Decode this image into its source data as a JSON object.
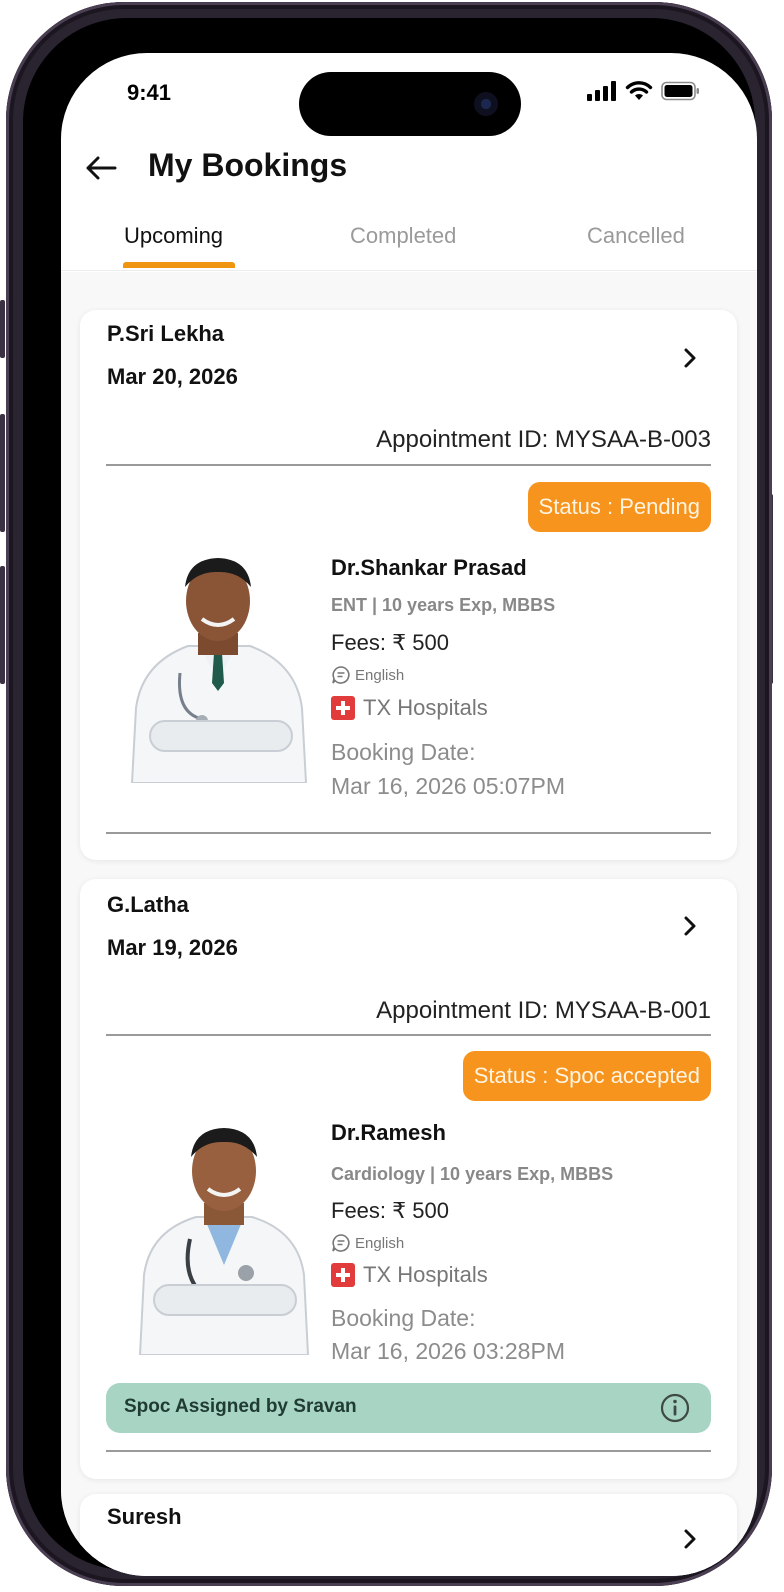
{
  "status_bar": {
    "time": "9:41"
  },
  "header": {
    "title": "My Bookings"
  },
  "tabs": [
    {
      "label": "Upcoming",
      "active": true
    },
    {
      "label": "Completed",
      "active": false
    },
    {
      "label": "Cancelled",
      "active": false
    }
  ],
  "bookings": [
    {
      "patient_name": "P.Sri Lekha",
      "date": "Mar 20, 2026",
      "appointment_id": "Appointment ID: MYSAA-B-003",
      "status": "Status : Pending",
      "doctor_name": "Dr.Shankar Prasad",
      "specialty": "ENT | 10 years Exp, MBBS",
      "fees": "Fees: ₹ 500",
      "language": "English",
      "hospital": "TX Hospitals",
      "booking_date_label": "Booking Date:",
      "booking_date": "Mar 16, 2026 05:07PM"
    },
    {
      "patient_name": "G.Latha",
      "date": "Mar 19, 2026",
      "appointment_id": "Appointment ID: MYSAA-B-001",
      "status": "Status : Spoc accepted",
      "doctor_name": "Dr.Ramesh",
      "specialty": "Cardiology | 10 years Exp, MBBS",
      "fees": "Fees: ₹ 500",
      "language": "English",
      "hospital": "TX Hospitals",
      "booking_date_label": "Booking Date:",
      "booking_date": "Mar 16, 2026 03:28PM",
      "spoc_note": "Spoc Assigned by Sravan"
    },
    {
      "patient_name": "Suresh"
    }
  ],
  "colors": {
    "accent": "#f7941d",
    "tab_underline": "#f0950f",
    "spoc_bar": "#a7d4c3",
    "hospital_icon": "#e23b3b"
  }
}
